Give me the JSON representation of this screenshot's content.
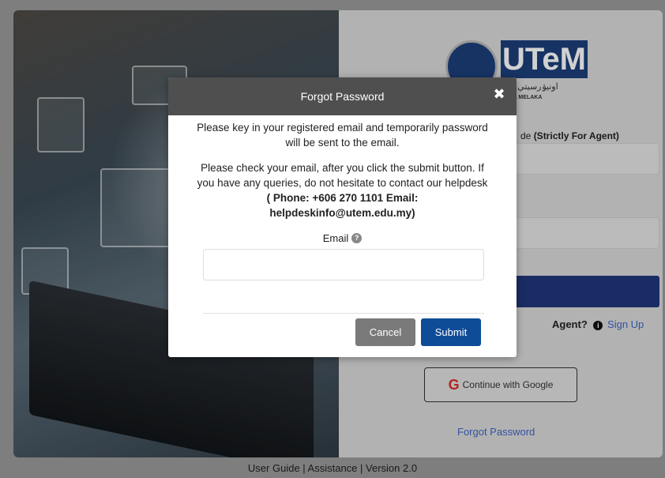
{
  "brand": {
    "logo_text": "UTeM",
    "jawi_text": "اونيۏرسيتي تيك",
    "sub_text": "AYSIA MELAKA"
  },
  "login": {
    "agent_label_prefix": "de ",
    "agent_label_bold": "(Strictly For Agent)",
    "agent_question": "Agent?",
    "signup_link": "Sign Up",
    "google_button": "Continue with Google",
    "forgot_link": "Forgot Password"
  },
  "footer": {
    "text": "User Guide | Assistance | Version 2.0"
  },
  "modal": {
    "title": "Forgot Password",
    "paragraph1": "Please key in your registered email and temporarily password will be sent to the email.",
    "paragraph2_prefix": "Please check your email, after you click the submit button. If you have any queries, do not hesitate to contact our helpdesk ",
    "paragraph2_bold": "( Phone: +606 270 1101 Email: helpdeskinfo@utem.edu.my)",
    "email_label": "Email",
    "email_value": "",
    "cancel_label": "Cancel",
    "submit_label": "Submit"
  },
  "colors": {
    "modal_header": "#4f4f4f",
    "submit": "#0f4c97",
    "cancel": "#7a7a7a",
    "login_button": "#1f3679",
    "link": "#3d64c7"
  },
  "icons": {
    "close": "close-icon",
    "help": "question-circle-icon",
    "info": "info-circle-icon",
    "google": "google-icon"
  }
}
